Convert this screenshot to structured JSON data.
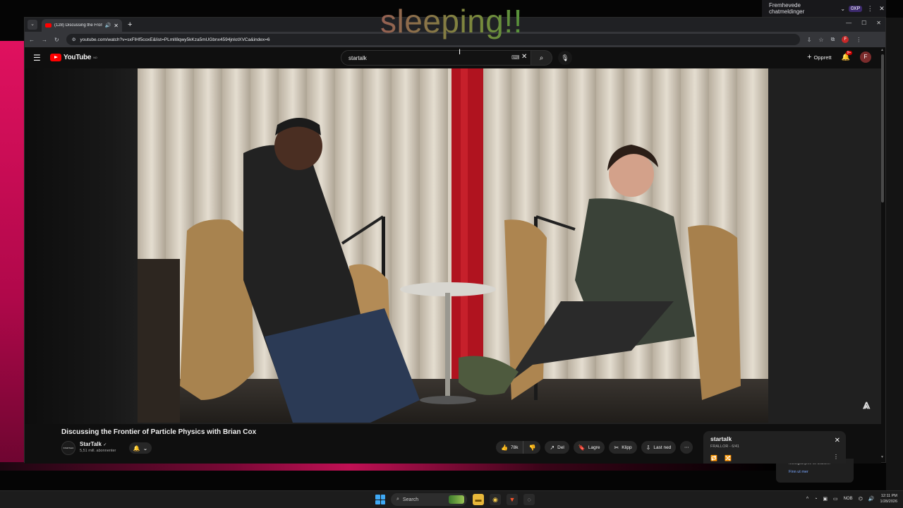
{
  "overlay": {
    "text": "sleeping!!"
  },
  "twitch_bar": {
    "label": "Fremhevede chatmeldinger",
    "xp": "0XP"
  },
  "browser": {
    "tab": {
      "title": "(128) Discussing the Fronti…"
    },
    "url": "youtube.com/watch?v=sxFlHf5coxE&list=PLmlI8qwy5kKza5mUGbnx4594jnlotXVCa&index=6"
  },
  "youtube": {
    "logo_text": "YouTube",
    "region": "NO",
    "search": {
      "query": "startalk"
    },
    "create_label": "Opprett",
    "notif_count": "9+",
    "avatar_letter": "F"
  },
  "video": {
    "title": "Discussing the Frontier of Particle Physics with Brian Cox",
    "channel": "StarTalk",
    "channel_avatar_text": "STARTALK",
    "subscribers": "5,51 mill. abonnenter",
    "likes": "78k",
    "share": "Del",
    "save": "Lagre",
    "clip": "Klipp",
    "download": "Last ned"
  },
  "playlist": {
    "title": "startalk",
    "subtitle": "FRALLOR - 6/41"
  },
  "popup": {
    "text": "retningslinjene for brukere.",
    "link": "Finn ut mer"
  },
  "taskbar": {
    "search_label": "Search",
    "lang": "NOB",
    "time": "12:11 PM",
    "date": "1/28/2026"
  },
  "colors": {
    "accent": "#ff0000",
    "pink": "#e0115f",
    "overlay_green": "#2e9c3a",
    "overlay_red": "#a34a5e"
  }
}
